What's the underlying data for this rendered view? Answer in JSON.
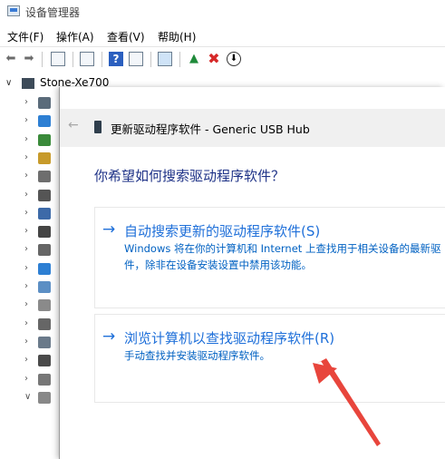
{
  "app": {
    "title": "设备管理器"
  },
  "menu": [
    "文件(F)",
    "操作(A)",
    "查看(V)",
    "帮助(H)"
  ],
  "tree": {
    "root": "Stone-Xe700"
  },
  "dialog": {
    "title": "更新驱动程序软件 - Generic USB Hub",
    "question": "你希望如何搜索驱动程序软件？",
    "option1": {
      "title": "自动搜索更新的驱动程序软件(S)",
      "desc1": "Windows 将在你的计算机和 Internet 上查找用于相关设备的最新驱",
      "desc2": "件，除非在设备安装设置中禁用该功能。"
    },
    "option2": {
      "title": "浏览计算机以查找驱动程序软件(R)",
      "desc": "手动查找并安装驱动程序软件。"
    }
  },
  "colors": {
    "link": "#1e6fd9",
    "heading": "#1e3287",
    "annotation": "#e8453c"
  }
}
